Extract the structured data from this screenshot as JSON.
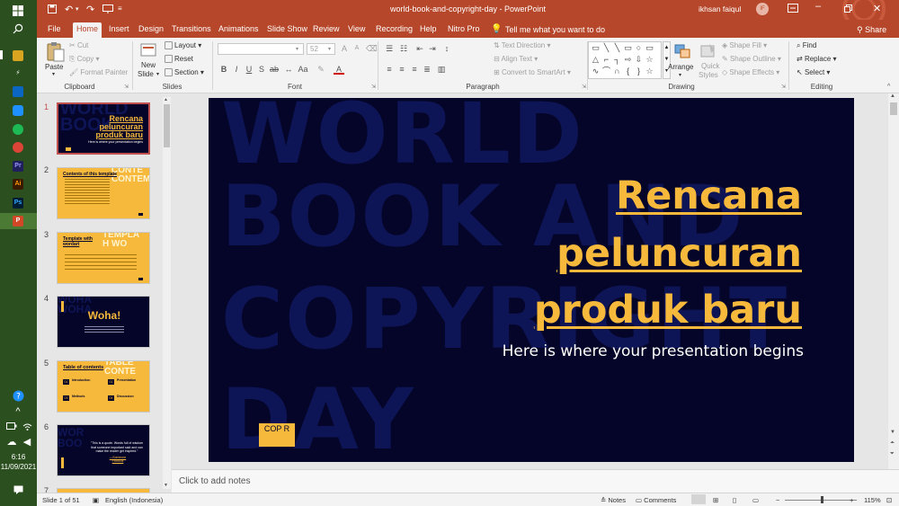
{
  "titlebar": {
    "doc_title": "world-book-and-copyright-day",
    "app_name": "PowerPoint",
    "user_name": "ikhsan faiqul",
    "user_initials": "IF"
  },
  "tabs": [
    "File",
    "Home",
    "Insert",
    "Design",
    "Transitions",
    "Animations",
    "Slide Show",
    "Review",
    "View",
    "Recording",
    "Help",
    "Nitro Pro"
  ],
  "tell_me": "Tell me what you want to do",
  "share_label": "Share",
  "ribbon": {
    "clipboard": {
      "label": "Clipboard",
      "paste": "Paste",
      "cut": "Cut",
      "copy": "Copy",
      "format_painter": "Format Painter"
    },
    "slides": {
      "label": "Slides",
      "new_slide_1": "New",
      "new_slide_2": "Slide",
      "layout": "Layout",
      "reset": "Reset",
      "section": "Section"
    },
    "font": {
      "label": "Font",
      "size": "52"
    },
    "paragraph": {
      "label": "Paragraph",
      "text_direction": "Text Direction",
      "align_text": "Align Text",
      "smartart": "Convert to SmartArt"
    },
    "drawing": {
      "label": "Drawing",
      "arrange": "Arrange",
      "quick_styles_1": "Quick",
      "quick_styles_2": "Styles",
      "shape_fill": "Shape Fill",
      "shape_outline": "Shape Outline",
      "shape_effects": "Shape Effects"
    },
    "editing": {
      "label": "Editing",
      "find": "Find",
      "replace": "Replace",
      "select": "Select"
    }
  },
  "thumbnails": [
    {
      "num": "1",
      "title": "Rencana peluncuran produk baru",
      "subtitle": "Here is where your presentation begins"
    },
    {
      "num": "2",
      "title": "Contents of this template"
    },
    {
      "num": "3",
      "title": "Template with wordart"
    },
    {
      "num": "4",
      "title": "Woha!"
    },
    {
      "num": "5",
      "title": "Table of contents",
      "items": [
        "Introduction",
        "Presentation",
        "Methods",
        "Discussion"
      ],
      "nums": [
        "01",
        "02",
        "03",
        "04"
      ]
    },
    {
      "num": "6",
      "title": "\"This is a quote. Words full of wisdom that someone important said and can make the reader get inspired.\"",
      "author": "—Someone Famous"
    },
    {
      "num": "7"
    }
  ],
  "slide": {
    "bg_words": [
      "WORLD",
      "BOOK AND",
      "COPYRIGHT",
      "DAY"
    ],
    "title_lines": [
      "Rencana",
      "peluncuran",
      "produk baru"
    ],
    "subtitle": "Here is where your presentation begins",
    "cop_label": "COP R"
  },
  "notes_placeholder": "Click to add notes",
  "status": {
    "slide_info": "Slide 1 of 51",
    "language": "English (Indonesia)",
    "notes": "Notes",
    "comments": "Comments",
    "zoom": "115%"
  },
  "taskbar": {
    "time": "6:16",
    "date": "11/09/2021"
  },
  "colors": {
    "accent": "#b7472a",
    "slide_bg": "#05052a",
    "title": "#f6b93b",
    "bg_word": "#0e1556"
  }
}
